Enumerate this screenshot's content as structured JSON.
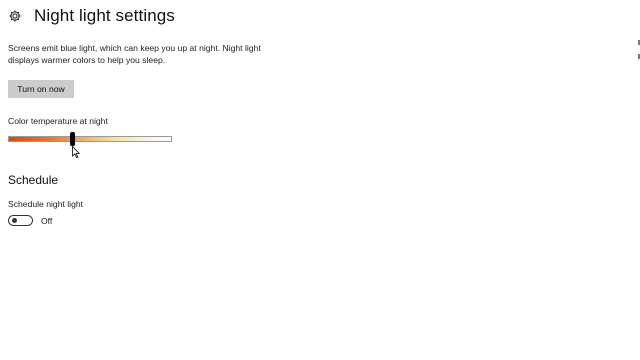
{
  "header": {
    "title": "Night light settings",
    "icon": "gear-icon"
  },
  "description": {
    "line1": "Screens emit blue light, which can keep you up at night. Night light",
    "line2": "displays warmer colors to help you sleep."
  },
  "turn_on_button": {
    "label": "Turn on now"
  },
  "color_temperature": {
    "label": "Color temperature at night",
    "level": 0.39,
    "gradient_colors": [
      "#d9470e",
      "#e8772a",
      "#f0b060",
      "#f7dca8",
      "#fcf4e6",
      "#ffffff"
    ]
  },
  "schedule": {
    "heading": "Schedule",
    "toggle_label": "Schedule night light",
    "toggle_state": "Off",
    "toggle_on": false
  }
}
